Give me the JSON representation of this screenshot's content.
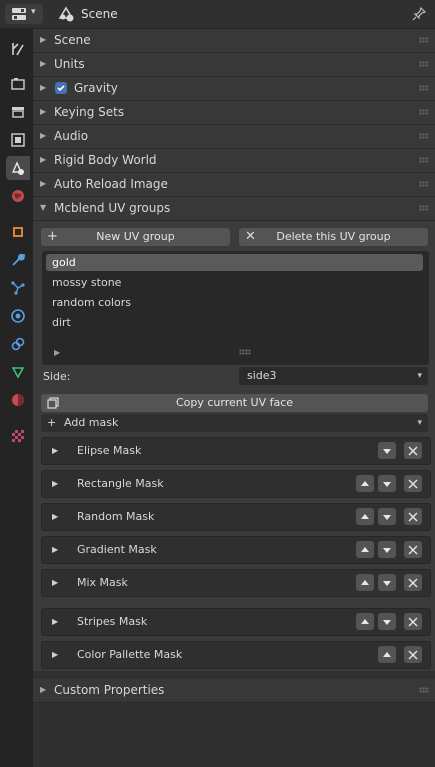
{
  "header": {
    "title": "Scene"
  },
  "tabs": [
    {
      "name": "tool-tab-icon"
    },
    {
      "name": "render-tab-icon"
    },
    {
      "name": "output-tab-icon"
    },
    {
      "name": "view-layer-tab-icon"
    },
    {
      "name": "scene-tab-icon",
      "active": true
    },
    {
      "name": "world-tab-icon"
    },
    {
      "name": "object-tab-icon"
    },
    {
      "name": "modifier-tab-icon"
    },
    {
      "name": "particles-tab-icon"
    },
    {
      "name": "physics-tab-icon"
    },
    {
      "name": "constraints-tab-icon"
    },
    {
      "name": "data-tab-icon"
    },
    {
      "name": "material-tab-icon"
    },
    {
      "name": "texture-tab-icon"
    }
  ],
  "panels": {
    "scene": "Scene",
    "units": "Units",
    "gravity": "Gravity",
    "keying_sets": "Keying Sets",
    "audio": "Audio",
    "rigid_body_world": "Rigid Body World",
    "auto_reload_image": "Auto Reload Image",
    "mcblend_uv_groups": "Mcblend UV groups",
    "custom_properties": "Custom Properties"
  },
  "uv_groups": {
    "new_button": "New UV group",
    "delete_button": "Delete this UV group",
    "items": [
      "gold",
      "mossy stone",
      "random colors",
      "dirt"
    ],
    "selected_index": 0,
    "side_label": "Side:",
    "side_value": "side3",
    "copy_button": "Copy current UV face",
    "add_mask": "Add mask",
    "masks": [
      {
        "label": "Elipse Mask"
      },
      {
        "label": "Rectangle Mask"
      },
      {
        "label": "Random Mask"
      },
      {
        "label": "Gradient Mask"
      },
      {
        "label": "Mix Mask"
      },
      {
        "label": "Stripes Mask"
      },
      {
        "label": "Color Pallette Mask"
      }
    ]
  },
  "colors": {
    "accent": "#4772b3",
    "background": "#303030",
    "panel": "#3b3b3b"
  }
}
